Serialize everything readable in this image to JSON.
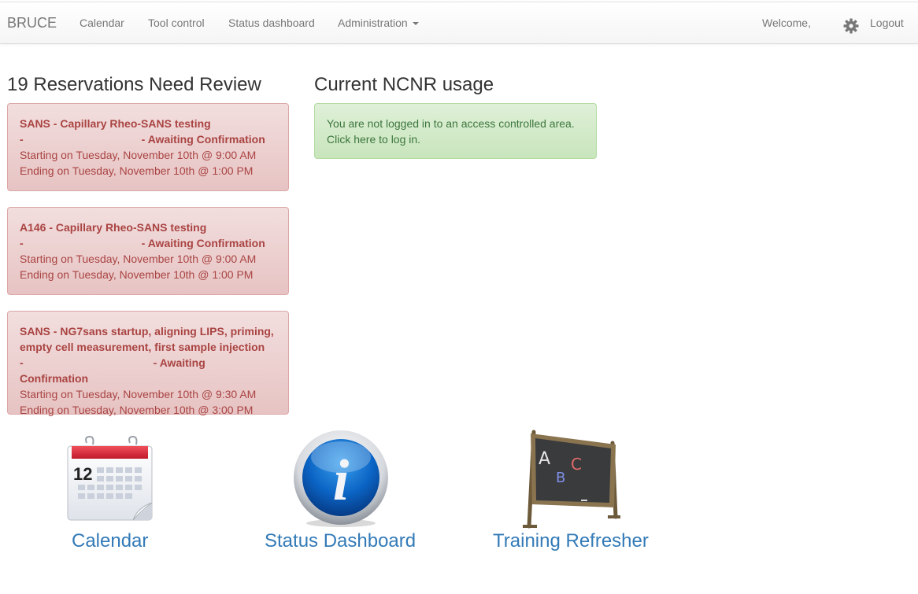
{
  "navbar": {
    "brand": "BRUCE",
    "links": [
      "Calendar",
      "Tool control",
      "Status dashboard",
      "Administration"
    ],
    "welcome": "Welcome,",
    "logout": "Logout",
    "settings_icon": "gear-icon"
  },
  "reservations": {
    "heading": "19 Reservations Need Review",
    "items": [
      {
        "title": "SANS - Capillary Rheo-SANS testing",
        "status": "- Awaiting Confirmation",
        "start": "Starting on Tuesday, November 10th @ 9:00 AM",
        "end": "Ending on Tuesday, November 10th @ 1:00 PM"
      },
      {
        "title": "A146 - Capillary Rheo-SANS testing",
        "status": "- Awaiting Confirmation",
        "start": "Starting on Tuesday, November 10th @ 9:00 AM",
        "end": "Ending on Tuesday, November 10th @ 1:00 PM"
      },
      {
        "title": "SANS - NG7sans startup, aligning LIPS, priming,",
        "title2": "empty cell measurement, first sample injection",
        "status": "- Awaiting Confirmation",
        "start": "Starting on Tuesday, November 10th @ 9:30 AM",
        "end": "Ending on Tuesday, November 10th @ 3:00 PM"
      }
    ]
  },
  "usage": {
    "heading": "Current NCNR usage",
    "line1": "You are not logged in to an access controlled area.",
    "line2": "Click here to log in."
  },
  "tiles": [
    {
      "label": "Calendar",
      "icon": "calendar-icon",
      "day": "12"
    },
    {
      "label": "Status Dashboard",
      "icon": "info-icon",
      "glyph": "i"
    },
    {
      "label": "Training Refresher",
      "icon": "chalkboard-icon",
      "letters": [
        "A",
        "B",
        "C"
      ]
    }
  ],
  "colors": {
    "danger_text": "#a94442",
    "success_text": "#3c763d",
    "link": "#337ab7"
  }
}
